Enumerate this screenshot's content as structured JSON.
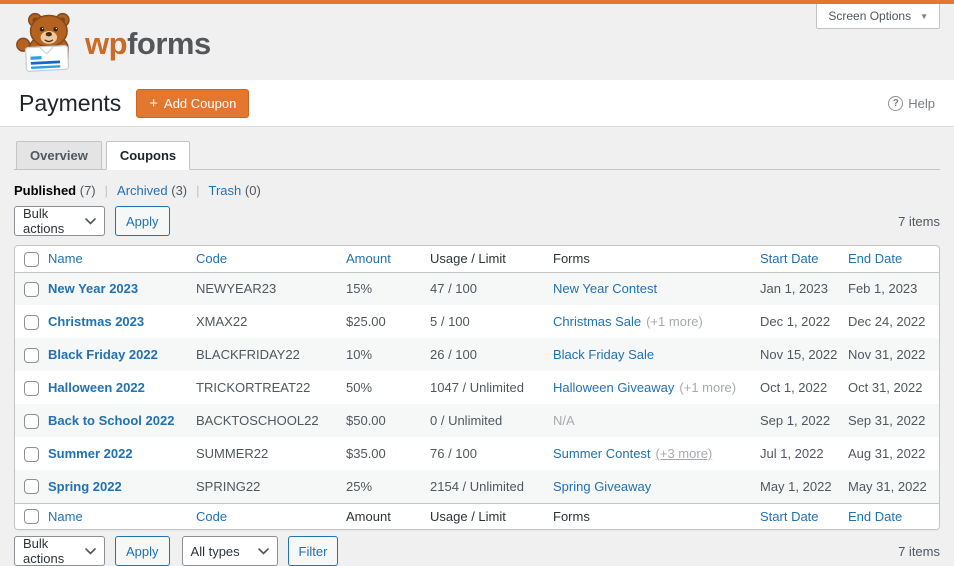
{
  "screen_options": {
    "label": "Screen Options",
    "icon": "▼"
  },
  "logo": {
    "brand_prefix": "wp",
    "brand_suffix": "forms"
  },
  "toolbar": {
    "title": "Payments",
    "add_coupon_icon": "+",
    "add_coupon_label": "Add Coupon",
    "help_icon": "?",
    "help_label": "Help"
  },
  "tabs": [
    {
      "label": "Overview",
      "active": false
    },
    {
      "label": "Coupons",
      "active": true
    }
  ],
  "subview_separator": "|",
  "subviews": [
    {
      "label": "Published",
      "count": "(7)",
      "current": true
    },
    {
      "label": "Archived",
      "count": "(3)",
      "current": false
    },
    {
      "label": "Trash",
      "count": "(0)",
      "current": false
    }
  ],
  "top_bar": {
    "bulk_actions": "Bulk actions",
    "apply": "Apply",
    "items": "7 items"
  },
  "bottom_bar": {
    "bulk_actions": "Bulk actions",
    "apply": "Apply",
    "type_filter": "All types",
    "filter": "Filter",
    "items": "7 items"
  },
  "table": {
    "head_columns": [
      {
        "label": "Name",
        "link": true
      },
      {
        "label": "Code",
        "link": true
      },
      {
        "label": "Amount",
        "link": true
      },
      {
        "label": "Usage / Limit",
        "link": false
      },
      {
        "label": "Forms",
        "link": false
      },
      {
        "label": "Start Date",
        "link": true
      },
      {
        "label": "End Date",
        "link": true
      }
    ],
    "foot_columns": [
      {
        "label": "Name",
        "link": true
      },
      {
        "label": "Code",
        "link": true
      },
      {
        "label": "Amount",
        "link": false
      },
      {
        "label": "Usage / Limit",
        "link": false
      },
      {
        "label": "Forms",
        "link": false
      },
      {
        "label": "Start Date",
        "link": true
      },
      {
        "label": "End Date",
        "link": true
      }
    ],
    "rows": [
      {
        "name": "New Year 2023",
        "code": "NEWYEAR23",
        "amount": "15%",
        "usage": "47 / 100",
        "form_link": "New Year Contest",
        "form_extra": "",
        "form_extra_underlined": false,
        "start": "Jan 1, 2023",
        "end": "Feb 1, 2023"
      },
      {
        "name": "Christmas 2023",
        "code": "XMAX22",
        "amount": "$25.00",
        "usage": "5 / 100",
        "form_link": "Christmas Sale",
        "form_extra": "(+1 more)",
        "form_extra_underlined": false,
        "start": "Dec 1, 2022",
        "end": "Dec 24, 2022"
      },
      {
        "name": "Black Friday 2022",
        "code": "BLACKFRIDAY22",
        "amount": "10%",
        "usage": "26 / 100",
        "form_link": "Black Friday Sale",
        "form_extra": "",
        "form_extra_underlined": false,
        "start": "Nov 15, 2022",
        "end": "Nov 31, 2022"
      },
      {
        "name": "Halloween 2022",
        "code": "TRICKORTREAT22",
        "amount": "50%",
        "usage": "1047 / Unlimited",
        "form_link": "Halloween Giveaway",
        "form_extra": "(+1 more)",
        "form_extra_underlined": false,
        "start": "Oct 1, 2022",
        "end": "Oct 31, 2022"
      },
      {
        "name": "Back to School 2022",
        "code": "BACKTOSCHOOL22",
        "amount": "$50.00",
        "usage": "0 / Unlimited",
        "form_link": "",
        "form_na": "N/A",
        "form_extra": "",
        "form_extra_underlined": false,
        "start": "Sep 1, 2022",
        "end": "Sep 31, 2022"
      },
      {
        "name": "Summer 2022",
        "code": "SUMMER22",
        "amount": "$35.00",
        "usage": "76 / 100",
        "form_link": "Summer Contest",
        "form_extra": "(+3 more)",
        "form_extra_underlined": true,
        "start": "Jul 1, 2022",
        "end": "Aug 31, 2022"
      },
      {
        "name": "Spring 2022",
        "code": "SPRING22",
        "amount": "25%",
        "usage": "2154 / Unlimited",
        "form_link": "Spring Giveaway",
        "form_extra": "",
        "form_extra_underlined": false,
        "start": "May 1, 2022",
        "end": "May 31, 2022"
      }
    ]
  },
  "colors": {
    "accent_orange": "#e27730",
    "link_blue": "#2271b1",
    "stripe": "#f6f7f7",
    "muted": "#a7aaad"
  }
}
